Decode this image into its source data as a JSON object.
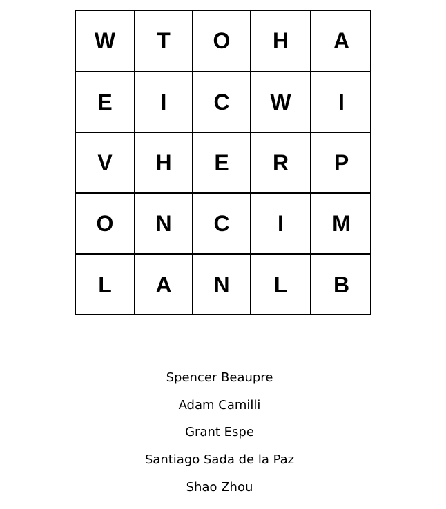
{
  "puzzle": {
    "grid": [
      [
        "W",
        "T",
        "O",
        "H",
        "A"
      ],
      [
        "E",
        "I",
        "C",
        "W",
        "I"
      ],
      [
        "V",
        "H",
        "E",
        "R",
        "P"
      ],
      [
        "O",
        "N",
        "C",
        "I",
        "M"
      ],
      [
        "L",
        "A",
        "N",
        "L",
        "B"
      ]
    ]
  },
  "credits": {
    "names": [
      "Spencer Beaupre",
      "Adam Camilli",
      "Grant Espe",
      "Santiago Sada de la Paz",
      "Shao Zhou"
    ]
  }
}
